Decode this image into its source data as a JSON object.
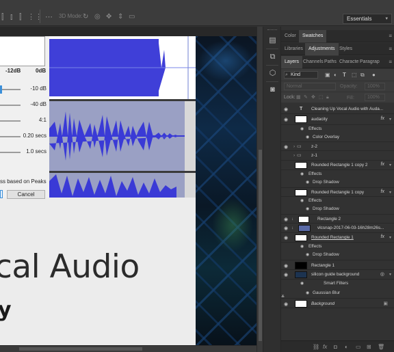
{
  "options_bar": {
    "mode_label": "3D Mode:",
    "workspace": "Essentials"
  },
  "dialog": {
    "meter_left": "-12dB",
    "meter_right": "0dB",
    "rows": [
      {
        "value": "-10 dB",
        "fill": 0.1
      },
      {
        "value": "-40 dB",
        "fill": 0.0
      },
      {
        "value": "4:1",
        "fill": 0.0
      },
      {
        "value": "0.20 secs",
        "fill": 0.0
      },
      {
        "value": "1.0 secs",
        "fill": 0.0
      }
    ],
    "peaks_label": "ss based on Peaks",
    "cancel_label": "Cancel"
  },
  "artboard": {
    "headline": "cal Audio",
    "subline": "y"
  },
  "panels": {
    "row1": [
      "Color",
      "Swatches"
    ],
    "row2": [
      "Libraries",
      "Adjustments",
      "Styles"
    ],
    "row3": [
      "Layers",
      "Channels",
      "Paths",
      "Characte",
      "Paragrap"
    ],
    "kind": "Kind",
    "blend": "Normal",
    "opacity_label": "Opacity:",
    "opacity_value": "100%",
    "lock_label": "Lock:",
    "fill_label": "Fill:",
    "fill_value": "100%"
  },
  "layers": [
    {
      "name": "Cleaning Up Vocal Audio with Auda...",
      "kind": "text"
    },
    {
      "name": "audacity",
      "kind": "smart",
      "fx": true
    },
    {
      "name": "Effects",
      "kind": "effects"
    },
    {
      "name": "Color Overlay",
      "kind": "effect"
    },
    {
      "name": "z-2",
      "kind": "group"
    },
    {
      "name": "z-1",
      "kind": "group"
    },
    {
      "name": "Rounded Rectangle 1 copy 2",
      "kind": "shape",
      "fx": true
    },
    {
      "name": "Effects",
      "kind": "effects"
    },
    {
      "name": "Drop Shadow",
      "kind": "effect"
    },
    {
      "name": "Rounded Rectangle 1 copy",
      "kind": "shape",
      "fx": true
    },
    {
      "name": "Effects",
      "kind": "effects"
    },
    {
      "name": "Drop Shadow",
      "kind": "effect"
    },
    {
      "name": "Rectangle 2",
      "kind": "clip"
    },
    {
      "name": "vlcsnap-2017-06-03-16h28m26s...",
      "kind": "clip"
    },
    {
      "name": "Rounded Rectangle 1",
      "kind": "shape",
      "fx": true
    },
    {
      "name": "Effects",
      "kind": "effects"
    },
    {
      "name": "Drop Shadow",
      "kind": "effect"
    },
    {
      "name": "Rectangle 1",
      "kind": "pixel"
    },
    {
      "name": "silicon guide background",
      "kind": "smart"
    },
    {
      "name": "Smart Filters",
      "kind": "filters"
    },
    {
      "name": "Gaussian Blur",
      "kind": "effect"
    },
    {
      "name": "Background",
      "kind": "background"
    }
  ]
}
